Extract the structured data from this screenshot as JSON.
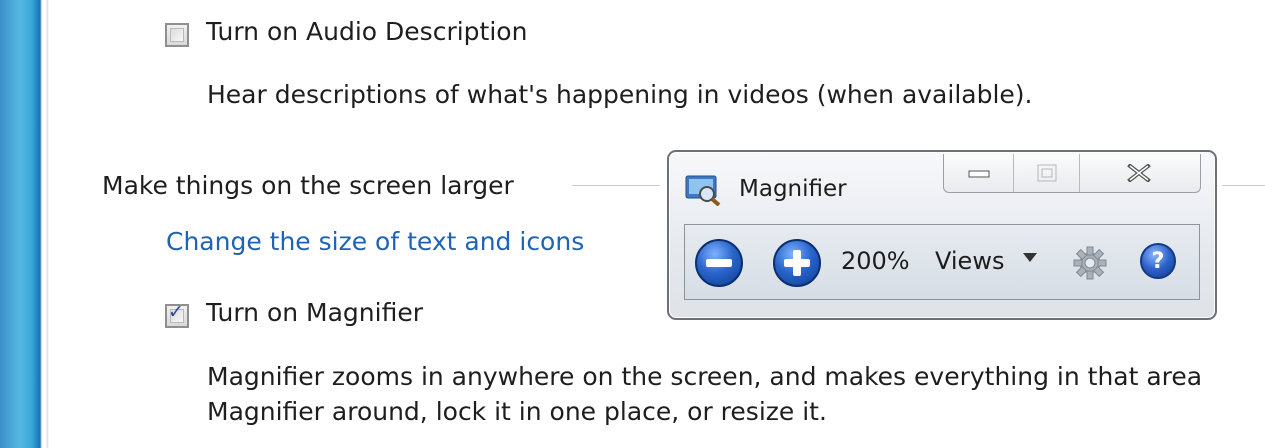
{
  "audio_description": {
    "checkbox_label": "Turn on Audio Description",
    "checked": false,
    "description": "Hear descriptions of what's happening in videos (when available)."
  },
  "section": {
    "heading": "Make things on the screen larger",
    "link": "Change the size of text and icons"
  },
  "magnifier_option": {
    "checkbox_label": "Turn on Magnifier",
    "checked": true,
    "description_line1": "Magnifier zooms in anywhere on the screen, and makes everything in that area",
    "description_line2": "Magnifier around, lock it in one place, or resize it."
  },
  "magnifier_window": {
    "title": "Magnifier",
    "zoom_level": "200%",
    "views_label": "Views",
    "icons": [
      "zoom-out-icon",
      "zoom-in-icon",
      "chevron-down-icon",
      "gear-icon",
      "help-icon",
      "minimize-icon",
      "maximize-icon",
      "close-icon"
    ]
  },
  "colors": {
    "link": "#1f63b7",
    "accent_blue": "#2a66cc"
  }
}
